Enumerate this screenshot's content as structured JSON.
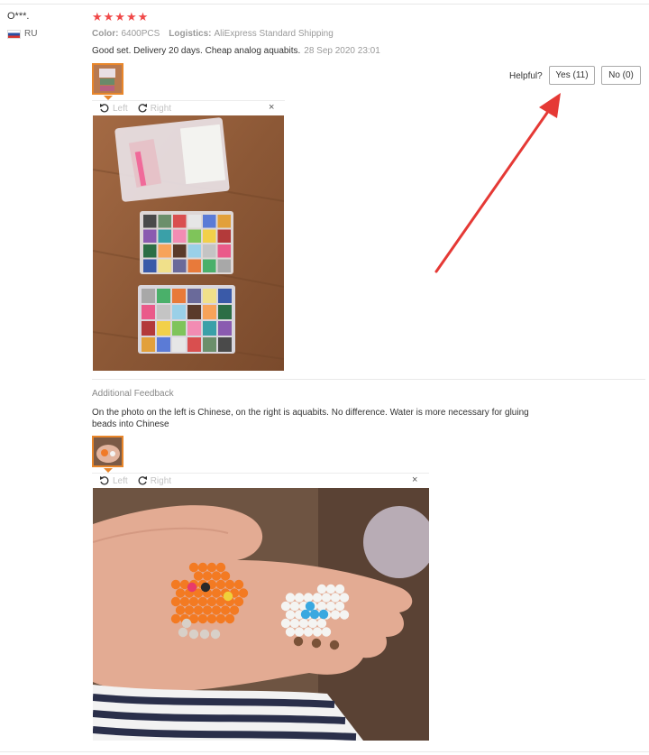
{
  "review": {
    "user": "O***.",
    "country": "RU",
    "stars": "★★★★★",
    "color_label": "Color:",
    "color_value": "6400PCS",
    "logistics_label": "Logistics:",
    "logistics_value": "AliExpress Standard Shipping",
    "text": "Good set. Delivery 20 days. Cheap analog aquabits.",
    "date": "28 Sep 2020 23:01"
  },
  "helpful": {
    "label": "Helpful?",
    "yes": "Yes (11)",
    "no": "No (0)"
  },
  "viewer": {
    "left": "Left",
    "right": "Right",
    "close": "×"
  },
  "additional": {
    "title": "Additional Feedback",
    "text": "On the photo on the left is Chinese, on the right is aquabits. No difference. Water is more necessary for gluing beads into Chinese"
  },
  "colors": {
    "star": "#f04848",
    "thumb_border": "#e8862b",
    "arrow": "#e53935"
  }
}
